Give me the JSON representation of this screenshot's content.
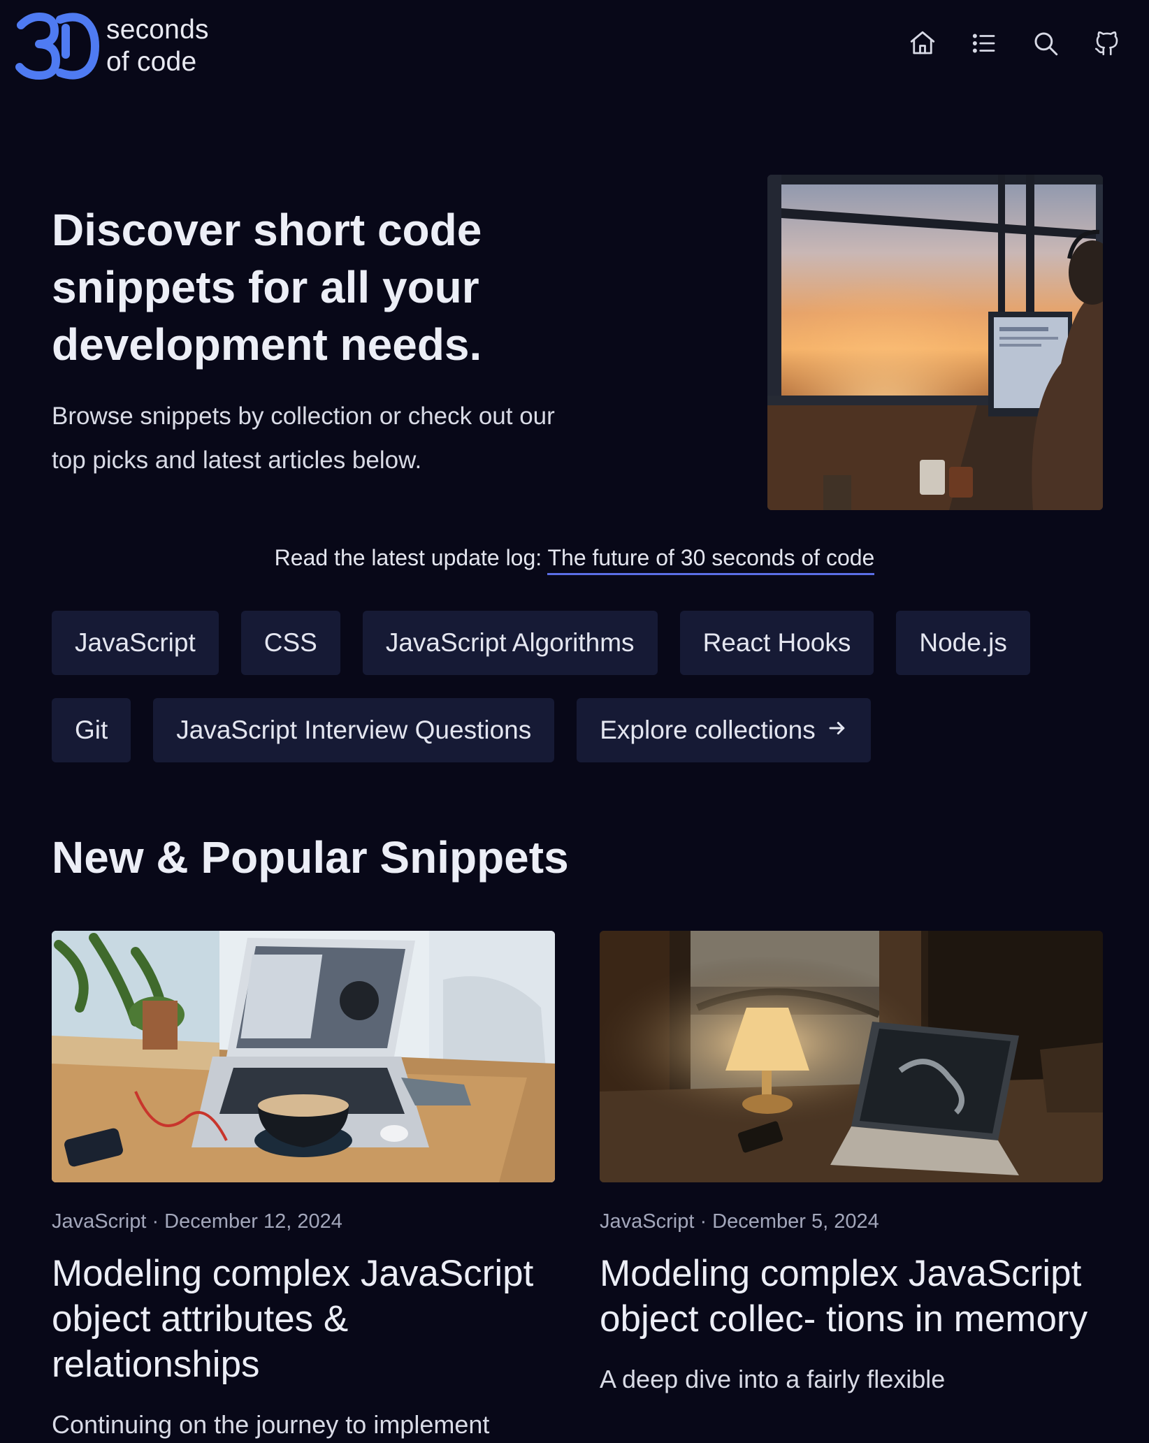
{
  "header": {
    "logo": {
      "mark": "30",
      "line1": "seconds",
      "line2": "of code"
    },
    "nav": [
      {
        "icon": "home-icon"
      },
      {
        "icon": "list-icon"
      },
      {
        "icon": "search-icon"
      },
      {
        "icon": "github-icon"
      }
    ]
  },
  "hero": {
    "title": "Discover short code snippets for all your development needs.",
    "subtitle": "Browse snippets by collection or check out our top picks and latest articles below."
  },
  "update_log": {
    "prefix": "Read the latest update log: ",
    "link": "The future of 30 seconds of code"
  },
  "collections": [
    {
      "label": "JavaScript"
    },
    {
      "label": "CSS"
    },
    {
      "label": "JavaScript Algorithms"
    },
    {
      "label": "React Hooks"
    },
    {
      "label": "Node.js"
    },
    {
      "label": "Git"
    },
    {
      "label": "JavaScript Interview Questions"
    }
  ],
  "explore": {
    "label": "Explore collections",
    "icon": "arrow-right-icon"
  },
  "section": {
    "title": "New & Popular Snippets"
  },
  "cards": [
    {
      "meta": "JavaScript · December 12, 2024",
      "title": "Modeling complex JavaScript object attributes & relationships",
      "description": "Continuing on the journey to implement"
    },
    {
      "meta": "JavaScript · December 5, 2024",
      "title": "Modeling complex JavaScript object collec- tions in memory",
      "description": "A deep dive into a fairly flexible"
    }
  ],
  "colors": {
    "background": "#080818",
    "chip": "#161a35",
    "accent": "#5b6ee6",
    "logo": "#4f7bf2"
  }
}
